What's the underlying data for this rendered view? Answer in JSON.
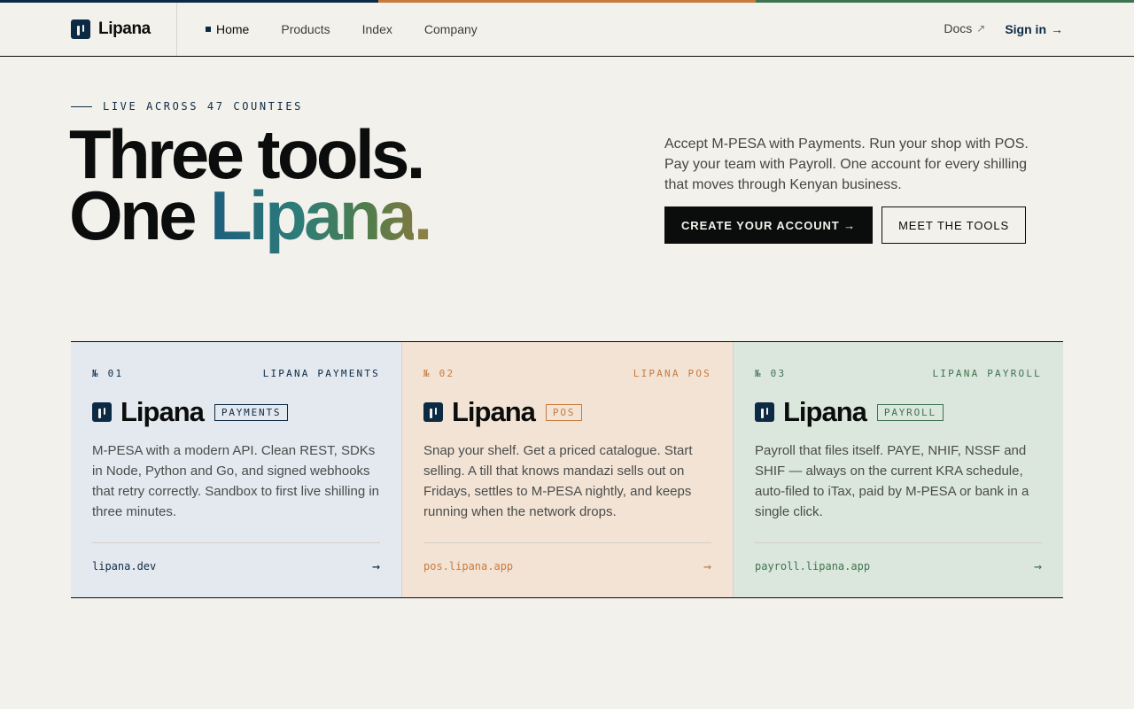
{
  "colors": {
    "stripe": [
      "#0d2a45",
      "#c87a3e",
      "#3f7350"
    ],
    "payments": "#0d2a45",
    "pos": "#c87a3e",
    "payroll": "#3f7350"
  },
  "header": {
    "brand": "Lipana",
    "nav": [
      {
        "label": "Home",
        "active": true
      },
      {
        "label": "Products"
      },
      {
        "label": "Index"
      },
      {
        "label": "Company"
      }
    ],
    "docs_label": "Docs",
    "docs_icon": "external-arrow-icon",
    "signin_label": "Sign in",
    "signin_arrow": "→"
  },
  "hero": {
    "eyebrow": "LIVE ACROSS 47 COUNTIES",
    "headline_line1": "Three tools.",
    "headline_line2_prefix": "One ",
    "headline_line2_brand": "Lipana",
    "headline_line2_period": ".",
    "intro": "Accept M-PESA with Payments. Run your shop with POS. Pay your team with Payroll. One account for every shilling that moves through Kenyan business.",
    "cta_primary": "CREATE YOUR ACCOUNT →",
    "cta_secondary": "MEET THE TOOLS"
  },
  "products": [
    {
      "number": "№ 01",
      "product_name": "LIPANA PAYMENTS",
      "brand": "Lipana",
      "tag": "PAYMENTS",
      "description": "M-PESA with a modern API. Clean REST, SDKs in Node, Python and Go, and signed webhooks that retry correctly. Sandbox to first live shilling in three minutes.",
      "url": "lipana.dev",
      "arrow": "→"
    },
    {
      "number": "№ 02",
      "product_name": "LIPANA POS",
      "brand": "Lipana",
      "tag": "POS",
      "description": "Snap your shelf. Get a priced catalogue. Start selling. A till that knows mandazi sells out on Fridays, settles to M-PESA nightly, and keeps running when the network drops.",
      "url": "pos.lipana.app",
      "arrow": "→"
    },
    {
      "number": "№ 03",
      "product_name": "LIPANA PAYROLL",
      "brand": "Lipana",
      "tag": "PAYROLL",
      "description": "Payroll that files itself. PAYE, NHIF, NSSF and SHIF — always on the current KRA schedule, auto-filed to iTax, paid by M-PESA or bank in a single click.",
      "url": "payroll.lipana.app",
      "arrow": "→"
    }
  ]
}
